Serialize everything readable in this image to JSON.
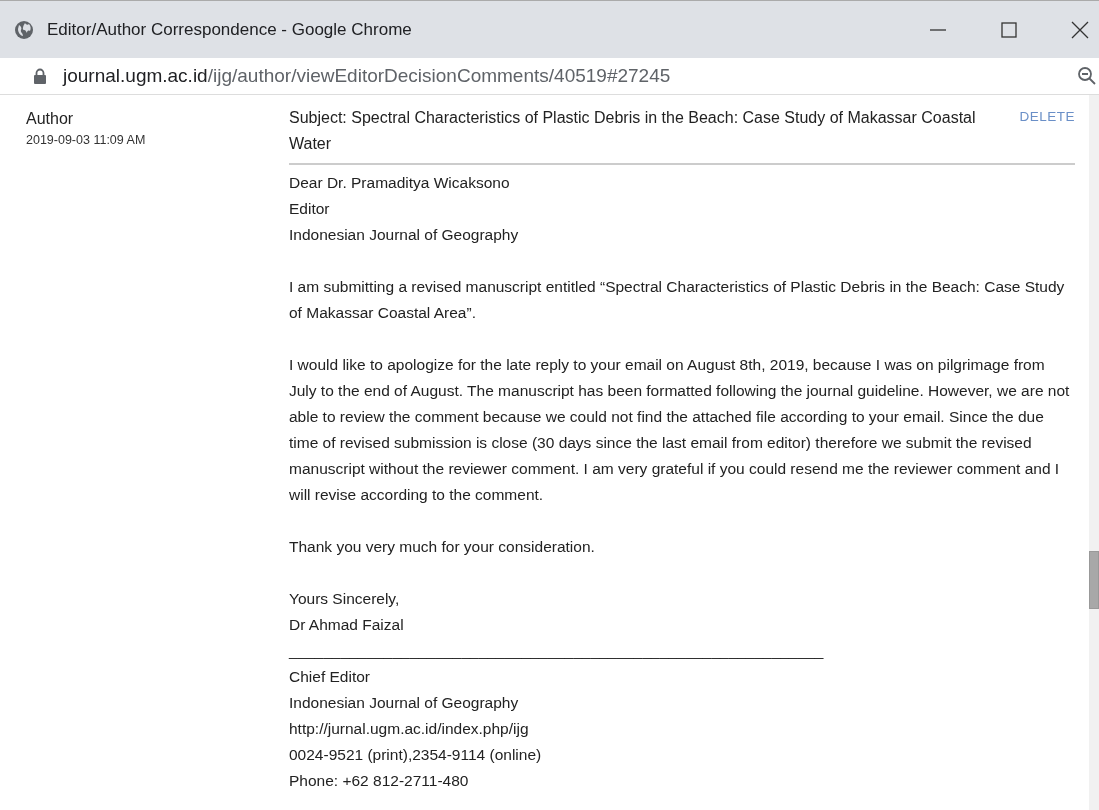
{
  "window": {
    "title": "Editor/Author Correspondence - Google Chrome"
  },
  "address_bar": {
    "host": "journal.ugm.ac.id",
    "path": "/ijg/author/viewEditorDecisionComments/40519#27245"
  },
  "comment": {
    "author": "Author",
    "date": "2019-09-03 11:09 AM",
    "subject": "Subject: Spectral Characteristics of Plastic Debris in the Beach: Case Study of Makassar Coastal Water",
    "delete_link": "DELETE",
    "body": [
      {
        "lines": [
          "Dear Dr. Pramaditya Wicaksono",
          "Editor",
          "Indonesian Journal of Geography"
        ]
      },
      {
        "lines": [
          "I am submitting a revised manuscript entitled “Spectral Characteristics of Plastic Debris in the Beach: Case Study of Makassar Coastal Area”."
        ]
      },
      {
        "lines": [
          "I would like to apologize for the late reply to your email on August 8th, 2019, because I was on pilgrimage from July to the end of August. The manuscript has been formatted following the journal guideline. However, we are not able to review the comment because we could not find the attached file according to your email. Since the due time of revised submission is close (30 days since the last email from editor) therefore we submit the revised manuscript without the reviewer comment. I am very grateful if you could resend me the reviewer comment and I will revise according to the comment."
        ]
      },
      {
        "lines": [
          "Thank you very much for your consideration."
        ]
      },
      {
        "lines": [
          "Yours Sincerely,",
          "Dr Ahmad Faizal",
          "______________________________________________________________",
          "Chief Editor",
          "Indonesian Journal of Geography",
          "http://jurnal.ugm.ac.id/index.php/ijg",
          "0024-9521 (print),2354-9114 (online)",
          "Phone: +62 812-2711-480"
        ]
      }
    ]
  }
}
